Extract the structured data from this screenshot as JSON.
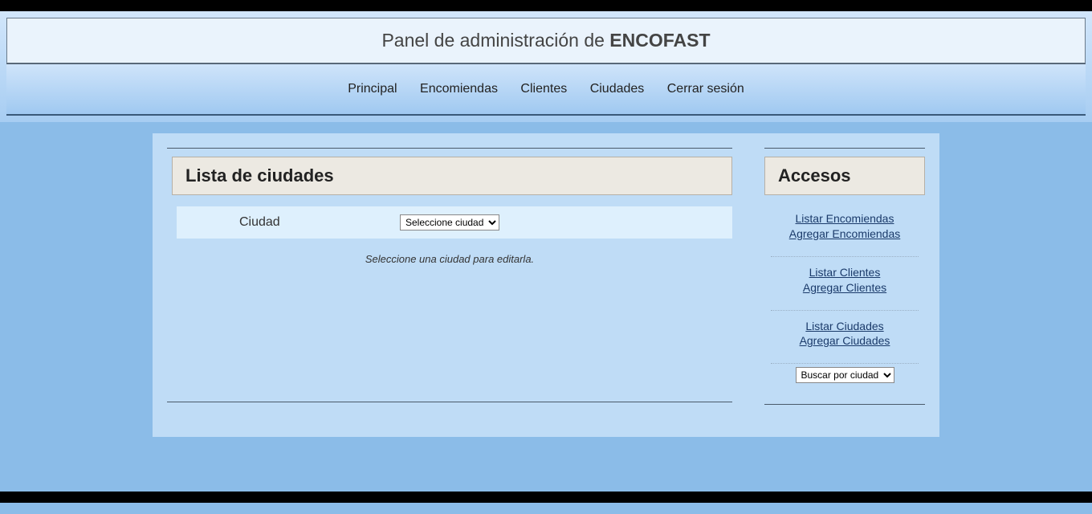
{
  "header": {
    "title_prefix": "Panel de administración de ",
    "title_brand": "ENCOFAST"
  },
  "nav": {
    "items": [
      "Principal",
      "Encomiendas",
      "Clientes",
      "Ciudades",
      "Cerrar sesión"
    ]
  },
  "main": {
    "title": "Lista de ciudades",
    "field_label": "Ciudad",
    "select_option": "Seleccione ciudad",
    "hint": "Seleccione una ciudad para editarla."
  },
  "side": {
    "title": "Accesos",
    "groups": [
      {
        "links": [
          "Listar Encomiendas",
          "Agregar Encomiendas"
        ]
      },
      {
        "links": [
          "Listar Clientes",
          "Agregar Clientes"
        ]
      },
      {
        "links": [
          "Listar Ciudades",
          "Agregar Ciudades"
        ]
      }
    ],
    "search_option": "Buscar por ciudad"
  }
}
